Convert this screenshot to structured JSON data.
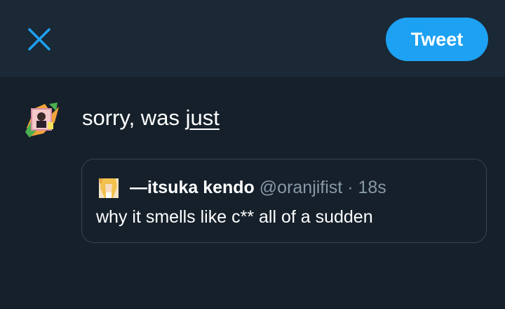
{
  "header": {
    "tweet_button_label": "Tweet",
    "colors": {
      "accent": "#1da1f2",
      "header_bg": "#1b2835",
      "page_bg": "#15202b"
    }
  },
  "compose": {
    "text_prefix": "sorry, was ",
    "text_link": "just"
  },
  "quote": {
    "display_name": "—itsuka kendo",
    "handle": "@oranjifist",
    "separator": "·",
    "time": "18s",
    "body": "why it smells like c** all of a sudden"
  }
}
